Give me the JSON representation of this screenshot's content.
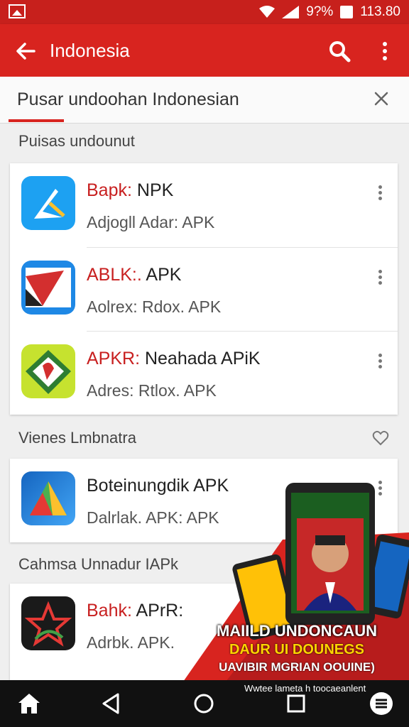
{
  "status_bar": {
    "battery_text": "9?%",
    "time": "113.80"
  },
  "app_bar": {
    "title": "Indonesia"
  },
  "search": {
    "query": "Pusar undoohan Indonesian"
  },
  "sections": [
    {
      "label": "Puisas undounut",
      "apps": [
        {
          "name_red": "Bapk:",
          "name": " NPK",
          "sub": "Adjogll  Adar:  APK",
          "icon": "blue-arrow-icon"
        },
        {
          "name_red": "ABLK:.",
          "name": " APK",
          "sub": "Aolrex:  Rdox.  APK",
          "icon": "red-flag-icon"
        },
        {
          "name_red": "APKR:",
          "name": " Neahada APiK",
          "sub": "Adres:  Rtlox.  APK",
          "icon": "green-leaf-icon"
        }
      ]
    },
    {
      "label": "Vienes Lmbnatra",
      "apps": [
        {
          "name_red": "",
          "name": "Boteinungdik APK",
          "sub": "Dalrlak.  APK:  APK",
          "icon": "triangle-gradient-icon"
        }
      ]
    },
    {
      "label": "Cahmsa Unnadur IAPk",
      "apps": [
        {
          "name_red": "Bahk:",
          "name": " APrR:",
          "sub": "Adrbk.  APK.",
          "icon": "star-dark-icon"
        }
      ]
    }
  ],
  "promo": {
    "line1": "MAIILD UNDONCAUN",
    "line2": "DAUR UI DOUNEGS",
    "line3": "UAVIBIR MGRIAN OOUINE)"
  },
  "nav_bar": {
    "caption": "Wwtee lameta h toocaeanlent"
  },
  "colors": {
    "primary": "#d8241f",
    "status_bar": "#c7201c",
    "nav_bar": "#111111"
  }
}
